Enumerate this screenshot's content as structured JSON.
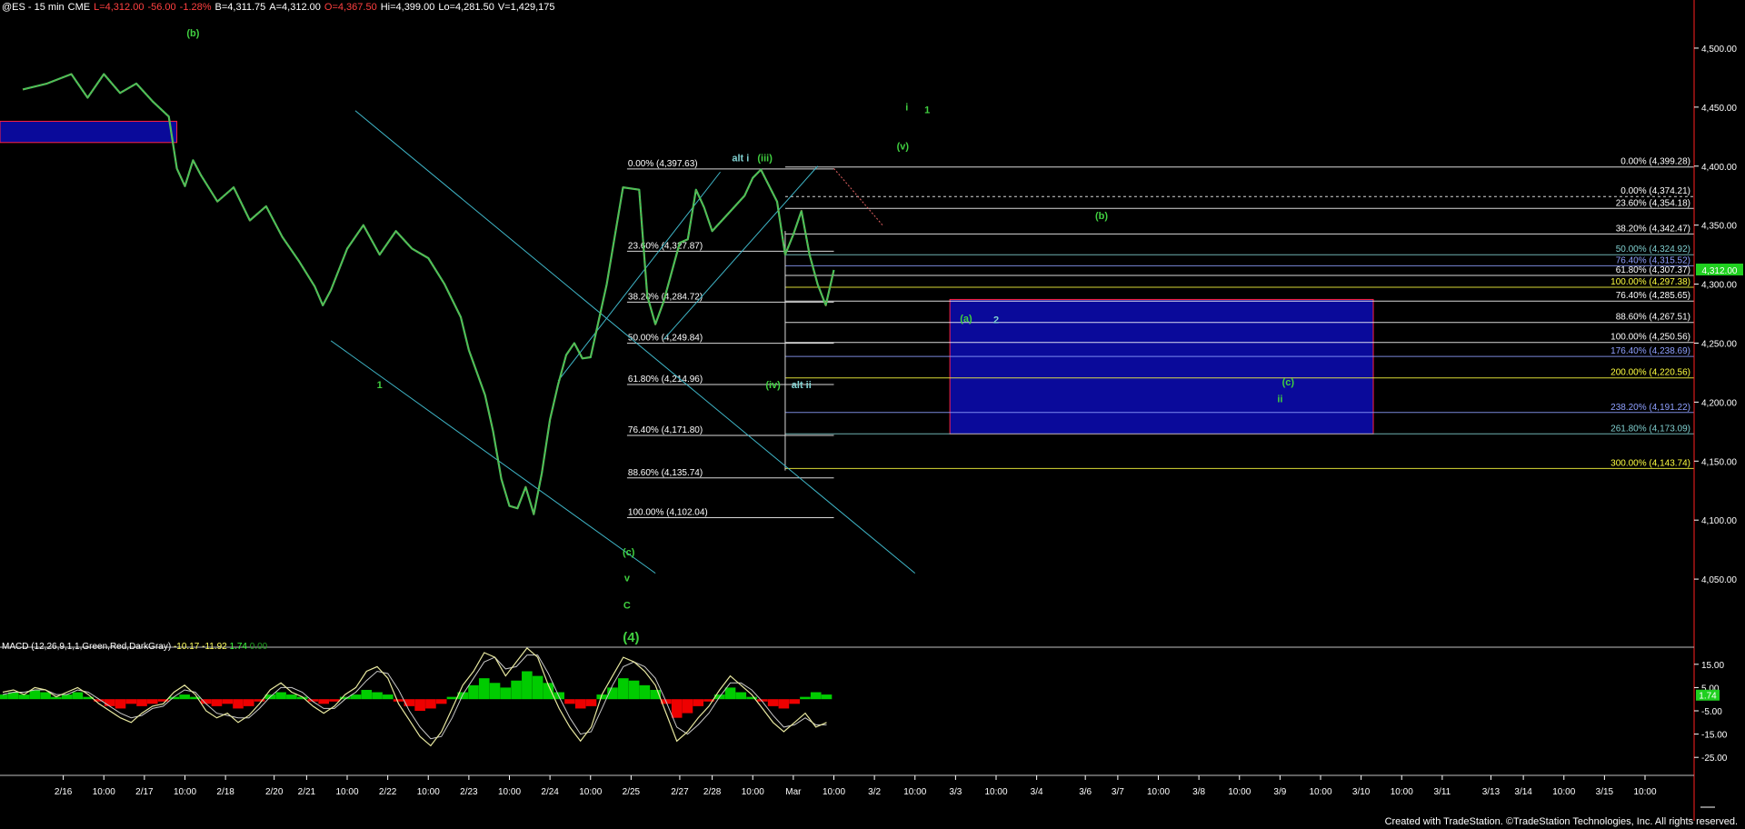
{
  "header": {
    "symbol": "@ES - 15 min",
    "exchange": "CME",
    "last": "L=4,312.00",
    "change": "-56.00",
    "change_pct": "-1.28%",
    "bid": "B=4,311.75",
    "ask": "A=4,312.00",
    "open": "O=4,367.50",
    "high": "Hi=4,399.00",
    "low": "Lo=4,281.50",
    "volume": "V=1,429,175"
  },
  "colors": {
    "background": "#000000",
    "price_axis": "#ffffff",
    "fib_white": "#ffffff",
    "fib_yellow": "#ffff40",
    "fib_blue": "#8fa0ff",
    "fib_cyan": "#80d0d0",
    "channel": "#3fb6c8",
    "wave_green": "#40d040",
    "support_box": "#0a0a9a",
    "support_box_edge": "#ff2040",
    "macd_up": "#00cc00",
    "macd_down": "#ee0000",
    "macd_line_1": "#e8e8a0",
    "macd_line_2": "#c8c8c8",
    "last_price_tag": "#20d020"
  },
  "icons": [
    "trendline-tool-icon"
  ],
  "chart_data": {
    "type": "line",
    "title": "@ES - 15 min",
    "price_axis": {
      "range": [
        4000,
        4530
      ],
      "ticks": [
        "4,500.00",
        "4,450.00",
        "4,400.00",
        "4,350.00",
        "4,300.00",
        "4,250.00",
        "4,200.00",
        "4,150.00",
        "4,100.00",
        "4,050.00"
      ],
      "tick_values": [
        4500,
        4450,
        4400,
        4350,
        4300,
        4250,
        4200,
        4150,
        4100,
        4050
      ],
      "last_price_label": "4,312.00",
      "last_price": 4312
    },
    "time_axis": {
      "labels": [
        "2/16",
        "10:00",
        "2/17",
        "10:00",
        "2/18",
        "2/20",
        "2/21",
        "10:00",
        "2/22",
        "10:00",
        "2/23",
        "10:00",
        "2/24",
        "10:00",
        "2/25",
        "2/27",
        "2/28",
        "10:00",
        "Mar",
        "10:00",
        "3/2",
        "10:00",
        "3/3",
        "10:00",
        "3/4",
        "3/6",
        "3/7",
        "10:00",
        "3/8",
        "10:00",
        "3/9",
        "10:00",
        "3/10",
        "10:00",
        "3/11",
        "3/13",
        "3/14",
        "10:00",
        "3/15",
        "10:00"
      ],
      "index": [
        0.05,
        0.1,
        0.15,
        0.2,
        0.25,
        0.31,
        0.35,
        0.4,
        0.45,
        0.5,
        0.55,
        0.6,
        0.65,
        0.7,
        0.75,
        0.81,
        0.85,
        0.9,
        0.95,
        1.0,
        1.05,
        1.1,
        1.15,
        1.2,
        1.25,
        1.31,
        1.35,
        1.4,
        1.45,
        1.5,
        1.55,
        1.6,
        1.65,
        1.7,
        1.75,
        1.81,
        1.85,
        1.9,
        1.95,
        2.0
      ]
    },
    "price_series": {
      "name": "@ES",
      "t": [
        0,
        0.03,
        0.06,
        0.08,
        0.1,
        0.12,
        0.14,
        0.16,
        0.18,
        0.19,
        0.2,
        0.21,
        0.22,
        0.24,
        0.26,
        0.28,
        0.3,
        0.32,
        0.34,
        0.36,
        0.37,
        0.38,
        0.4,
        0.42,
        0.44,
        0.46,
        0.48,
        0.5,
        0.52,
        0.54,
        0.55,
        0.57,
        0.58,
        0.59,
        0.6,
        0.61,
        0.62,
        0.63,
        0.64,
        0.65,
        0.66,
        0.67,
        0.68,
        0.69,
        0.7,
        0.72,
        0.74,
        0.76,
        0.77,
        0.78,
        0.79,
        0.8,
        0.81,
        0.82,
        0.83,
        0.84,
        0.85,
        0.87,
        0.89,
        0.9,
        0.91,
        0.93,
        0.94,
        0.95,
        0.96,
        0.97,
        0.98,
        0.99,
        1.0
      ],
      "close": [
        4465,
        4470,
        4478,
        4458,
        4478,
        4462,
        4470,
        4455,
        4442,
        4398,
        4383,
        4405,
        4392,
        4370,
        4382,
        4354,
        4366,
        4340,
        4320,
        4298,
        4282,
        4295,
        4330,
        4350,
        4325,
        4345,
        4330,
        4322,
        4300,
        4272,
        4244,
        4206,
        4175,
        4135,
        4112,
        4110,
        4128,
        4105,
        4140,
        4185,
        4215,
        4240,
        4250,
        4237,
        4238,
        4300,
        4382,
        4380,
        4290,
        4266,
        4285,
        4310,
        4335,
        4338,
        4380,
        4365,
        4345,
        4360,
        4375,
        4390,
        4397,
        4370,
        4325,
        4342,
        4362,
        4325,
        4300,
        4282,
        4312
      ]
    },
    "resistance_box": {
      "price_low": 4420,
      "price_high": 4438
    },
    "support_box": {
      "price_low": 4173,
      "price_high": 4287
    },
    "channel_lines": [
      {
        "points": [
          [
            0.41,
            4447
          ],
          [
            1.1,
            4055
          ]
        ]
      },
      {
        "points": [
          [
            0.38,
            4252
          ],
          [
            0.78,
            4055
          ]
        ]
      },
      {
        "points": [
          [
            0.66,
            4218
          ],
          [
            0.86,
            4395
          ]
        ]
      },
      {
        "points": [
          [
            0.79,
            4253
          ],
          [
            0.98,
            4400
          ]
        ]
      }
    ],
    "fib_left": [
      {
        "label": "0.00% (4,397.63)",
        "value": 4397.63,
        "color": "fib_white"
      },
      {
        "label": "23.60% (4,327.87)",
        "value": 4327.87,
        "color": "fib_white"
      },
      {
        "label": "38.20% (4,284.72)",
        "value": 4284.72,
        "color": "fib_white"
      },
      {
        "label": "50.00% (4,249.84)",
        "value": 4249.84,
        "color": "fib_white"
      },
      {
        "label": "61.80% (4,214.96)",
        "value": 4214.96,
        "color": "fib_white"
      },
      {
        "label": "76.40% (4,171.80)",
        "value": 4171.8,
        "color": "fib_white"
      },
      {
        "label": "88.60% (4,135.74)",
        "value": 4135.74,
        "color": "fib_white"
      },
      {
        "label": "100.00% (4,102.04)",
        "value": 4102.04,
        "color": "fib_white"
      }
    ],
    "fib_right": [
      {
        "label": "0.00% (4,399.28)",
        "value": 4399.28,
        "color": "fib_white"
      },
      {
        "label": "0.00% (4,374.21)",
        "value": 4374.21,
        "color": "fib_white",
        "dashed": true
      },
      {
        "label": "23.60% (4,354.18)",
        "value": 4364.18,
        "color": "fib_white"
      },
      {
        "label": "38.20% (4,342.47)",
        "value": 4342.47,
        "color": "fib_white"
      },
      {
        "label": "50.00% (4,324.92)",
        "value": 4324.92,
        "color": "fib_cyan"
      },
      {
        "label": "76.40% (4,315.52)",
        "value": 4315.52,
        "color": "fib_blue"
      },
      {
        "label": "61.80% (4,307.37)",
        "value": 4307.37,
        "color": "fib_white"
      },
      {
        "label": "100.00% (4,297.38)",
        "value": 4297.38,
        "color": "fib_yellow"
      },
      {
        "label": "76.40% (4,285.65)",
        "value": 4285.65,
        "color": "fib_white"
      },
      {
        "label": "88.60% (4,267.51)",
        "value": 4267.51,
        "color": "fib_white"
      },
      {
        "label": "100.00% (4,250.56)",
        "value": 4250.56,
        "color": "fib_white"
      },
      {
        "label": "176.40% (4,238.69)",
        "value": 4238.69,
        "color": "fib_blue"
      },
      {
        "label": "200.00% (4,220.56)",
        "value": 4220.56,
        "color": "fib_yellow"
      },
      {
        "label": "238.20% (4,191.22)",
        "value": 4191.22,
        "color": "fib_blue"
      },
      {
        "label": "261.80% (4,173.09)",
        "value": 4173.09,
        "color": "fib_cyan"
      },
      {
        "label": "300.00% (4,143.74)",
        "value": 4143.74,
        "color": "fib_yellow"
      }
    ],
    "wave_labels": [
      {
        "text": "(b)",
        "t": 0.21,
        "price": 4510,
        "color": "wave_green"
      },
      {
        "text": "1",
        "t": 0.44,
        "price": 4212,
        "color": "wave_green"
      },
      {
        "text": "alt i",
        "t": 0.885,
        "price": 4404,
        "color": "fib_cyan"
      },
      {
        "text": "(iii)",
        "t": 0.915,
        "price": 4404,
        "color": "wave_green"
      },
      {
        "text": "(iv)",
        "t": 0.925,
        "price": 4212,
        "color": "wave_green"
      },
      {
        "text": "alt ii",
        "t": 0.96,
        "price": 4212,
        "color": "fib_cyan"
      },
      {
        "text": "(v)",
        "t": 1.085,
        "price": 4414,
        "color": "wave_green"
      },
      {
        "text": "i",
        "t": 1.09,
        "price": 4447,
        "color": "wave_green"
      },
      {
        "text": "1",
        "t": 1.115,
        "price": 4445,
        "color": "wave_green"
      },
      {
        "text": "(b)",
        "t": 1.33,
        "price": 4355,
        "color": "wave_green"
      },
      {
        "text": "(a)",
        "t": 1.163,
        "price": 4268,
        "color": "wave_green"
      },
      {
        "text": "2",
        "t": 1.2,
        "price": 4267,
        "color": "fib_cyan"
      },
      {
        "text": "(c)",
        "t": 1.56,
        "price": 4214,
        "color": "wave_green"
      },
      {
        "text": "ii",
        "t": 1.55,
        "price": 4200,
        "color": "wave_green"
      },
      {
        "text": "(c)",
        "t": 0.747,
        "price": 4070,
        "color": "wave_green"
      },
      {
        "text": "v",
        "t": 0.745,
        "price": 4048,
        "color": "wave_green"
      },
      {
        "text": "C",
        "t": 0.745,
        "price": 4025,
        "color": "wave_green"
      },
      {
        "text": "(4)",
        "t": 0.75,
        "price": 3997,
        "color": "wave_green"
      }
    ],
    "macd": {
      "label": "MACD (12,26,9,1,1,Green,Red,DarkGray)",
      "values": [
        "-10.17",
        "-11.92",
        "1.74",
        "0.00"
      ],
      "range": [
        -30,
        20
      ],
      "ticks": [
        "15.00",
        "5.00",
        "-5.00",
        "-15.00",
        "-25.00"
      ],
      "tick_values": [
        15,
        5,
        -5,
        -15,
        -25
      ],
      "current_label": "1.74",
      "current": 1.74,
      "hist": [
        2,
        3,
        2,
        4,
        3,
        1,
        2,
        3,
        1,
        -1,
        -3,
        -4,
        -2,
        -3,
        -2,
        -1,
        1,
        2,
        1,
        -2,
        -3,
        -2,
        -4,
        -3,
        -1,
        2,
        3,
        2,
        1,
        -1,
        -2,
        -1,
        1,
        2,
        4,
        3,
        2,
        -1,
        -3,
        -5,
        -4,
        -2,
        1,
        3,
        6,
        9,
        7,
        5,
        8,
        12,
        10,
        7,
        3,
        -2,
        -4,
        -3,
        2,
        5,
        9,
        8,
        6,
        4,
        -2,
        -8,
        -6,
        -3,
        -1,
        2,
        5,
        3,
        1,
        -1,
        -3,
        -4,
        -2,
        1,
        3,
        2
      ],
      "macd_line": [
        3,
        4,
        2,
        5,
        4,
        1,
        3,
        5,
        2,
        -2,
        -5,
        -8,
        -10,
        -6,
        -3,
        -2,
        3,
        6,
        2,
        -5,
        -8,
        -6,
        -10,
        -7,
        -2,
        4,
        7,
        3,
        1,
        -3,
        -6,
        -3,
        2,
        5,
        12,
        14,
        9,
        -2,
        -9,
        -16,
        -20,
        -14,
        -4,
        6,
        12,
        20,
        18,
        10,
        16,
        22,
        18,
        6,
        -4,
        -12,
        -18,
        -12,
        2,
        10,
        18,
        16,
        12,
        6,
        -6,
        -18,
        -14,
        -8,
        -3,
        4,
        10,
        6,
        2,
        -4,
        -10,
        -14,
        -10,
        -6,
        -12,
        -10
      ],
      "signal_line": [
        2,
        3,
        3,
        4,
        4,
        2,
        2,
        4,
        3,
        0,
        -3,
        -6,
        -8,
        -7,
        -4,
        -3,
        1,
        4,
        3,
        -2,
        -6,
        -7,
        -8,
        -8,
        -4,
        1,
        5,
        5,
        3,
        -1,
        -4,
        -4,
        0,
        3,
        8,
        12,
        11,
        4,
        -5,
        -12,
        -17,
        -16,
        -8,
        2,
        9,
        16,
        18,
        13,
        14,
        19,
        19,
        11,
        1,
        -8,
        -15,
        -14,
        -4,
        6,
        14,
        16,
        14,
        9,
        -1,
        -12,
        -15,
        -11,
        -6,
        1,
        7,
        7,
        4,
        -1,
        -7,
        -12,
        -11,
        -8,
        -11,
        -11
      ]
    }
  },
  "footer": "Created with TradeStation. ©TradeStation Technologies, Inc. All rights reserved."
}
